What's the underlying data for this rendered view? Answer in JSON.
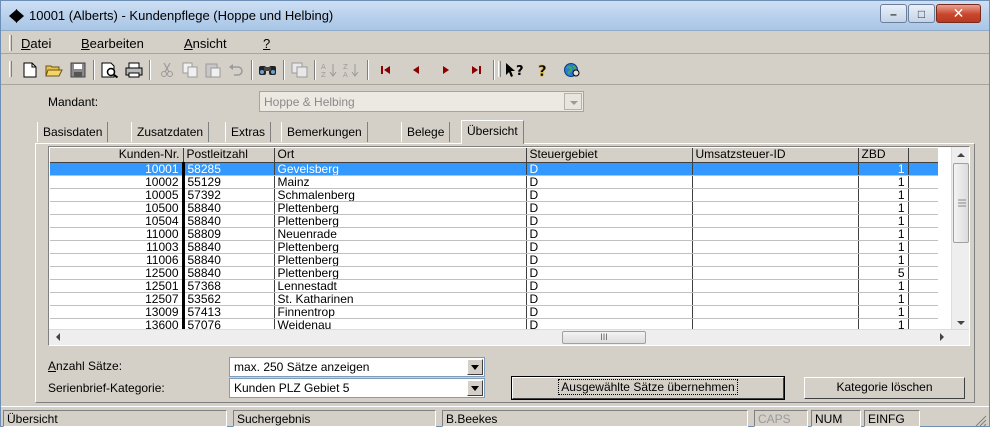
{
  "window": {
    "title": "10001 (Alberts) - Kundenpflege (Hoppe und Helbing)",
    "minimize": "–",
    "maximize": "□",
    "close": "✕"
  },
  "menu": [
    {
      "pre": "",
      "accel": "D",
      "post": "atei"
    },
    {
      "pre": "",
      "accel": "B",
      "post": "earbeiten"
    },
    {
      "pre": "",
      "accel": "A",
      "post": "nsicht"
    },
    {
      "pre": "",
      "accel": "?",
      "post": ""
    }
  ],
  "toolbar_icons": [
    "new-document-icon",
    "open-folder-icon",
    "save-icon",
    "print-preview-icon",
    "print-icon",
    "cut-icon",
    "copy-icon",
    "paste-icon",
    "undo-icon",
    "find-icon",
    "duplicate-icon",
    "sort-ascending-icon",
    "sort-descending-icon",
    "first-record-icon",
    "previous-record-icon",
    "next-record-icon",
    "last-record-icon",
    "context-help-icon",
    "help-icon",
    "web-icon"
  ],
  "mandant": {
    "label": "Mandant:",
    "value": "Hoppe & Helbing"
  },
  "tabs": [
    "Basisdaten",
    "Zusatzdaten",
    "Extras",
    "Bemerkungen",
    "Belege",
    "Übersicht"
  ],
  "active_tab": "Übersicht",
  "grid": {
    "columns": [
      "Kunden-Nr.",
      "Postleitzahl",
      "Ort",
      "Steuergebiet",
      "Umsatzsteuer-ID",
      "ZBD"
    ],
    "rows": [
      [
        "10001",
        "58285",
        "Gevelsberg",
        "D",
        "",
        "1"
      ],
      [
        "10002",
        "55129",
        "Mainz",
        "D",
        "",
        "1"
      ],
      [
        "10005",
        "57392",
        "Schmalenberg",
        "D",
        "",
        "1"
      ],
      [
        "10500",
        "58840",
        "Plettenberg",
        "D",
        "",
        "1"
      ],
      [
        "10504",
        "58840",
        "Plettenberg",
        "D",
        "",
        "1"
      ],
      [
        "11000",
        "58809",
        "Neuenrade",
        "D",
        "",
        "1"
      ],
      [
        "11003",
        "58840",
        "Plettenberg",
        "D",
        "",
        "1"
      ],
      [
        "11006",
        "58840",
        "Plettenberg",
        "D",
        "",
        "1"
      ],
      [
        "12500",
        "58840",
        "Plettenberg",
        "D",
        "",
        "5"
      ],
      [
        "12501",
        "57368",
        "Lennestadt",
        "D",
        "",
        "1"
      ],
      [
        "12507",
        "53562",
        "St. Katharinen",
        "D",
        "",
        "1"
      ],
      [
        "13009",
        "57413",
        "Finnentrop",
        "D",
        "",
        "1"
      ],
      [
        "13600",
        "57076",
        "Weidenau",
        "D",
        "",
        "1"
      ]
    ],
    "selected_row": 0,
    "hscroll_thumb_label": "III"
  },
  "bottom": {
    "anzahl_label_accel": "A",
    "anzahl_label_rest": "nzahl Sätze:",
    "anzahl_value": "max. 250 Sätze anzeigen",
    "serien_label": "Serienbrief-Kategorie:",
    "serien_value": "Kunden PLZ Gebiet 5",
    "btn_uebernehmen": "Ausgewählte Sätze übernehmen",
    "btn_loeschen": "Kategorie löschen"
  },
  "status": {
    "pane1": "Übersicht",
    "pane2": "Suchergebnis",
    "pane3": "B.Beekes",
    "caps": "CAPS",
    "num": "NUM",
    "einfg": "EINFG"
  }
}
